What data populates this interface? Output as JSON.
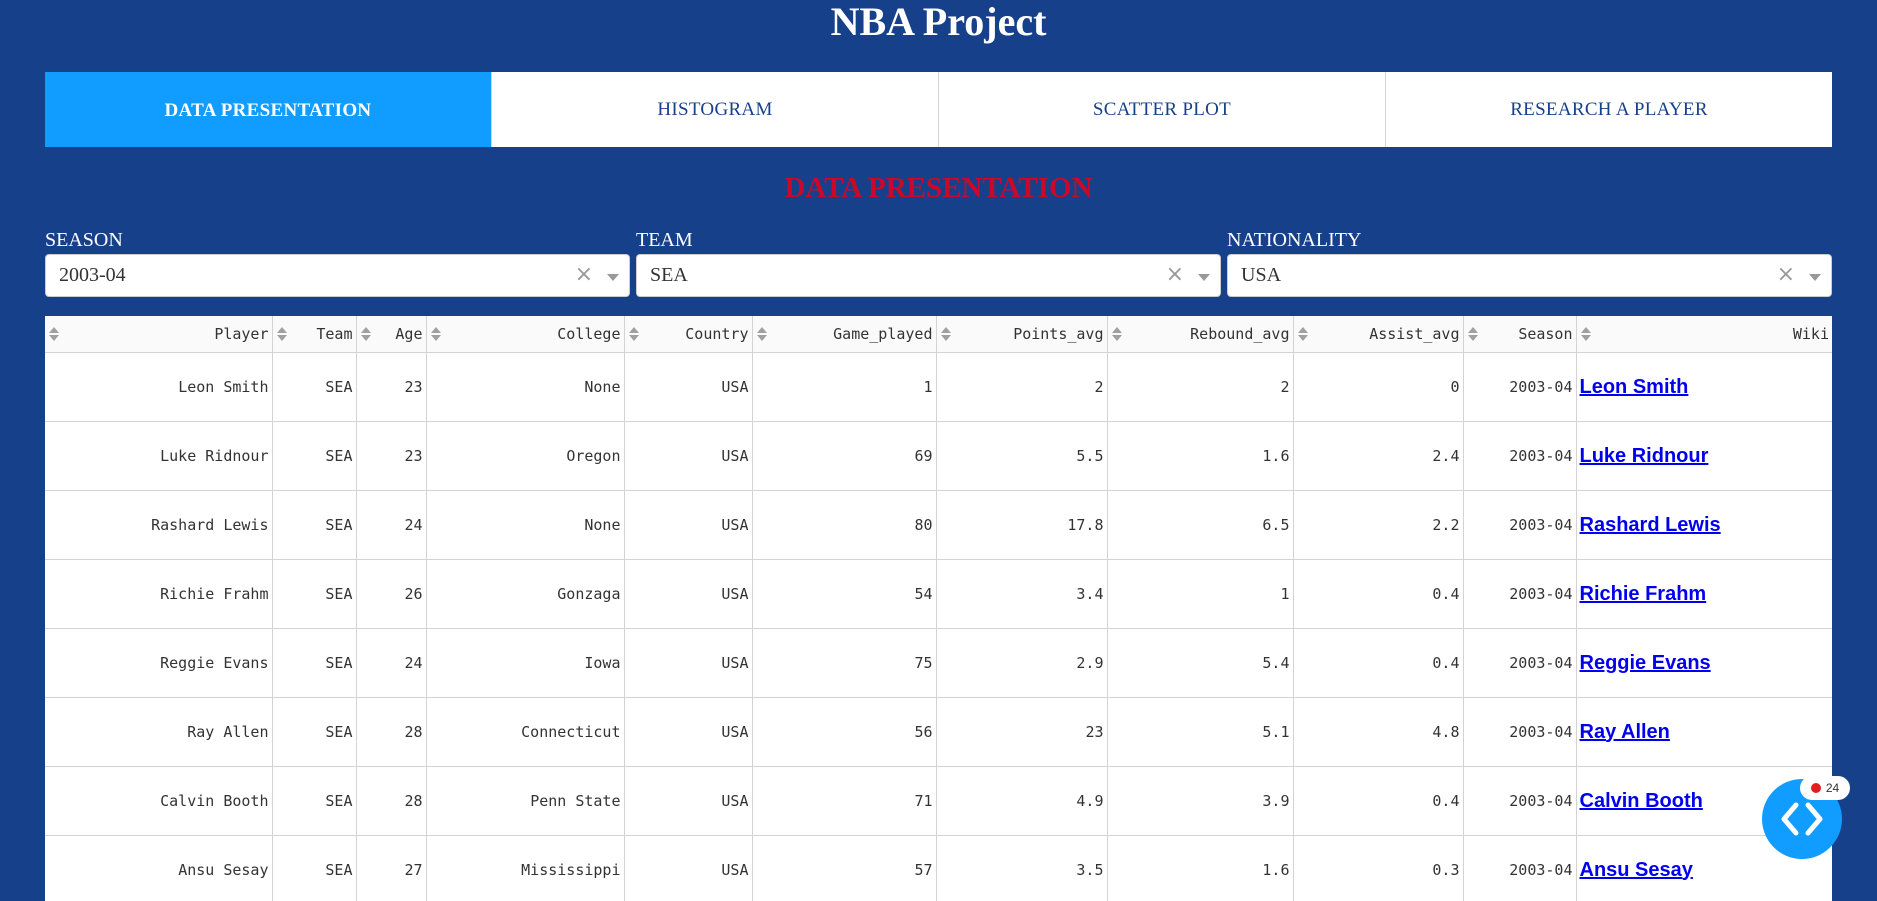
{
  "app": {
    "title": "NBA Project"
  },
  "tabs": [
    {
      "label": "DATA PRESENTATION",
      "active": true
    },
    {
      "label": "HISTOGRAM",
      "active": false
    },
    {
      "label": "SCATTER PLOT",
      "active": false
    },
    {
      "label": "RESEARCH A PLAYER",
      "active": false
    }
  ],
  "section": {
    "title": "DATA PRESENTATION"
  },
  "filters": [
    {
      "label": "SEASON",
      "value": "2003-04"
    },
    {
      "label": "TEAM",
      "value": "SEA"
    },
    {
      "label": "NATIONALITY",
      "value": "USA"
    }
  ],
  "table": {
    "columns": [
      "Player",
      "Team",
      "Age",
      "College",
      "Country",
      "Game_played",
      "Points_avg",
      "Rebound_avg",
      "Assist_avg",
      "Season",
      "Wiki"
    ],
    "rows": [
      [
        "Leon Smith",
        "SEA",
        "23",
        "None",
        "USA",
        "1",
        "2",
        "2",
        "0",
        "2003-04",
        "Leon Smith"
      ],
      [
        "Luke Ridnour",
        "SEA",
        "23",
        "Oregon",
        "USA",
        "69",
        "5.5",
        "1.6",
        "2.4",
        "2003-04",
        "Luke Ridnour"
      ],
      [
        "Rashard Lewis",
        "SEA",
        "24",
        "None",
        "USA",
        "80",
        "17.8",
        "6.5",
        "2.2",
        "2003-04",
        "Rashard Lewis"
      ],
      [
        "Richie Frahm",
        "SEA",
        "26",
        "Gonzaga",
        "USA",
        "54",
        "3.4",
        "1",
        "0.4",
        "2003-04",
        "Richie Frahm"
      ],
      [
        "Reggie Evans",
        "SEA",
        "24",
        "Iowa",
        "USA",
        "75",
        "2.9",
        "5.4",
        "0.4",
        "2003-04",
        "Reggie Evans"
      ],
      [
        "Ray Allen",
        "SEA",
        "28",
        "Connecticut",
        "USA",
        "56",
        "23",
        "5.1",
        "4.8",
        "2003-04",
        "Ray Allen"
      ],
      [
        "Calvin Booth",
        "SEA",
        "28",
        "Penn State",
        "USA",
        "71",
        "4.9",
        "3.9",
        "0.4",
        "2003-04",
        "Calvin Booth"
      ],
      [
        "Ansu Sesay",
        "SEA",
        "27",
        "Mississippi",
        "USA",
        "57",
        "3.5",
        "1.6",
        "0.3",
        "2003-04",
        "Ansu Sesay"
      ]
    ]
  },
  "debug": {
    "count": "24"
  },
  "colors": {
    "background": "#17408b",
    "tab_active": "#119dff",
    "section_title": "#c9082a",
    "link": "#0000ee"
  }
}
